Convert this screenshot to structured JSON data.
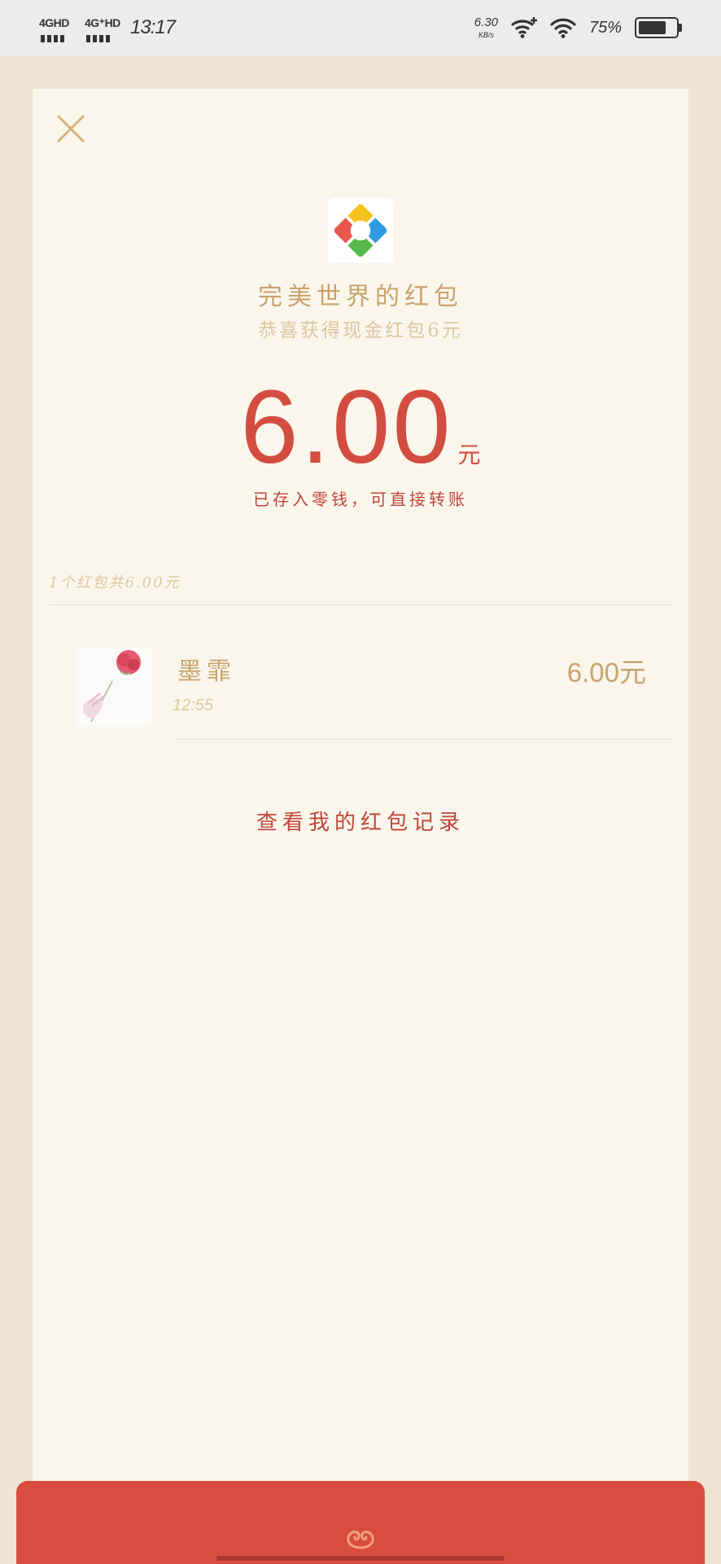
{
  "status_bar": {
    "signal1_label": "4GHD",
    "signal2_label": "4G⁺HD",
    "time": "13:17",
    "net_speed_value": "6.30",
    "net_speed_unit": "KB/s",
    "battery_percent": "75%",
    "battery_level": 0.75
  },
  "card": {
    "close_icon": "close-icon",
    "app_logo_icon": "perfect-world-logo-icon",
    "sender_title": "完美世界的红包",
    "greeting": "恭喜获得现金红包6元",
    "amount_value": "6.00",
    "amount_unit": "元",
    "stored_note": "已存入零钱，可直接转账",
    "summary": "1个红包共6.00元",
    "records": [
      {
        "avatar_icon": "rose-avatar-icon",
        "name": "墨霏",
        "time": "12:55",
        "amount": "6.00元"
      }
    ],
    "history_link": "查看我的红包记录"
  },
  "envelope": {
    "emblem_icon": "envelope-emblem-icon"
  },
  "colors": {
    "accent_red": "#d94d40",
    "gold_text": "#c9a36b",
    "card_bg": "#faf6ec",
    "page_bg": "#eee4d1"
  }
}
